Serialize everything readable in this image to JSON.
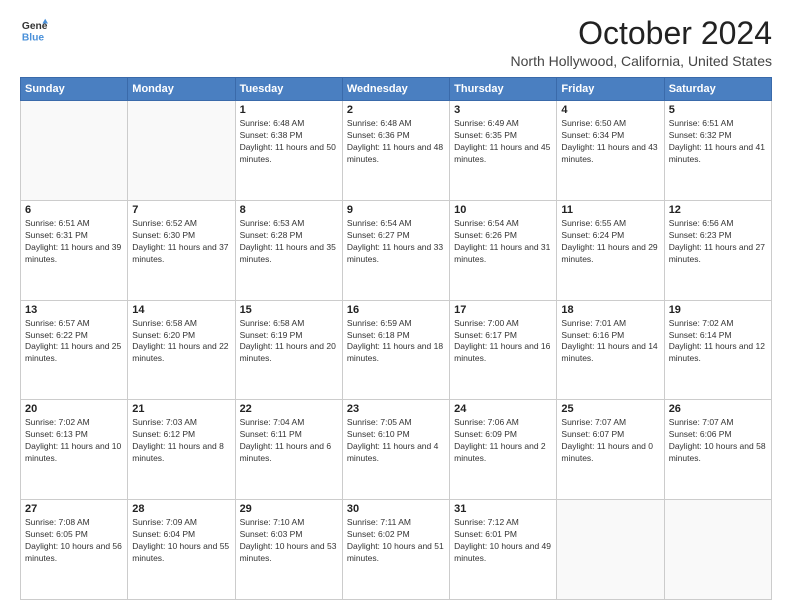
{
  "header": {
    "logo_line1": "General",
    "logo_line2": "Blue",
    "title": "October 2024",
    "subtitle": "North Hollywood, California, United States"
  },
  "days_of_week": [
    "Sunday",
    "Monday",
    "Tuesday",
    "Wednesday",
    "Thursday",
    "Friday",
    "Saturday"
  ],
  "weeks": [
    [
      {
        "day": "",
        "info": ""
      },
      {
        "day": "",
        "info": ""
      },
      {
        "day": "1",
        "info": "Sunrise: 6:48 AM\nSunset: 6:38 PM\nDaylight: 11 hours and 50 minutes."
      },
      {
        "day": "2",
        "info": "Sunrise: 6:48 AM\nSunset: 6:36 PM\nDaylight: 11 hours and 48 minutes."
      },
      {
        "day": "3",
        "info": "Sunrise: 6:49 AM\nSunset: 6:35 PM\nDaylight: 11 hours and 45 minutes."
      },
      {
        "day": "4",
        "info": "Sunrise: 6:50 AM\nSunset: 6:34 PM\nDaylight: 11 hours and 43 minutes."
      },
      {
        "day": "5",
        "info": "Sunrise: 6:51 AM\nSunset: 6:32 PM\nDaylight: 11 hours and 41 minutes."
      }
    ],
    [
      {
        "day": "6",
        "info": "Sunrise: 6:51 AM\nSunset: 6:31 PM\nDaylight: 11 hours and 39 minutes."
      },
      {
        "day": "7",
        "info": "Sunrise: 6:52 AM\nSunset: 6:30 PM\nDaylight: 11 hours and 37 minutes."
      },
      {
        "day": "8",
        "info": "Sunrise: 6:53 AM\nSunset: 6:28 PM\nDaylight: 11 hours and 35 minutes."
      },
      {
        "day": "9",
        "info": "Sunrise: 6:54 AM\nSunset: 6:27 PM\nDaylight: 11 hours and 33 minutes."
      },
      {
        "day": "10",
        "info": "Sunrise: 6:54 AM\nSunset: 6:26 PM\nDaylight: 11 hours and 31 minutes."
      },
      {
        "day": "11",
        "info": "Sunrise: 6:55 AM\nSunset: 6:24 PM\nDaylight: 11 hours and 29 minutes."
      },
      {
        "day": "12",
        "info": "Sunrise: 6:56 AM\nSunset: 6:23 PM\nDaylight: 11 hours and 27 minutes."
      }
    ],
    [
      {
        "day": "13",
        "info": "Sunrise: 6:57 AM\nSunset: 6:22 PM\nDaylight: 11 hours and 25 minutes."
      },
      {
        "day": "14",
        "info": "Sunrise: 6:58 AM\nSunset: 6:20 PM\nDaylight: 11 hours and 22 minutes."
      },
      {
        "day": "15",
        "info": "Sunrise: 6:58 AM\nSunset: 6:19 PM\nDaylight: 11 hours and 20 minutes."
      },
      {
        "day": "16",
        "info": "Sunrise: 6:59 AM\nSunset: 6:18 PM\nDaylight: 11 hours and 18 minutes."
      },
      {
        "day": "17",
        "info": "Sunrise: 7:00 AM\nSunset: 6:17 PM\nDaylight: 11 hours and 16 minutes."
      },
      {
        "day": "18",
        "info": "Sunrise: 7:01 AM\nSunset: 6:16 PM\nDaylight: 11 hours and 14 minutes."
      },
      {
        "day": "19",
        "info": "Sunrise: 7:02 AM\nSunset: 6:14 PM\nDaylight: 11 hours and 12 minutes."
      }
    ],
    [
      {
        "day": "20",
        "info": "Sunrise: 7:02 AM\nSunset: 6:13 PM\nDaylight: 11 hours and 10 minutes."
      },
      {
        "day": "21",
        "info": "Sunrise: 7:03 AM\nSunset: 6:12 PM\nDaylight: 11 hours and 8 minutes."
      },
      {
        "day": "22",
        "info": "Sunrise: 7:04 AM\nSunset: 6:11 PM\nDaylight: 11 hours and 6 minutes."
      },
      {
        "day": "23",
        "info": "Sunrise: 7:05 AM\nSunset: 6:10 PM\nDaylight: 11 hours and 4 minutes."
      },
      {
        "day": "24",
        "info": "Sunrise: 7:06 AM\nSunset: 6:09 PM\nDaylight: 11 hours and 2 minutes."
      },
      {
        "day": "25",
        "info": "Sunrise: 7:07 AM\nSunset: 6:07 PM\nDaylight: 11 hours and 0 minutes."
      },
      {
        "day": "26",
        "info": "Sunrise: 7:07 AM\nSunset: 6:06 PM\nDaylight: 10 hours and 58 minutes."
      }
    ],
    [
      {
        "day": "27",
        "info": "Sunrise: 7:08 AM\nSunset: 6:05 PM\nDaylight: 10 hours and 56 minutes."
      },
      {
        "day": "28",
        "info": "Sunrise: 7:09 AM\nSunset: 6:04 PM\nDaylight: 10 hours and 55 minutes."
      },
      {
        "day": "29",
        "info": "Sunrise: 7:10 AM\nSunset: 6:03 PM\nDaylight: 10 hours and 53 minutes."
      },
      {
        "day": "30",
        "info": "Sunrise: 7:11 AM\nSunset: 6:02 PM\nDaylight: 10 hours and 51 minutes."
      },
      {
        "day": "31",
        "info": "Sunrise: 7:12 AM\nSunset: 6:01 PM\nDaylight: 10 hours and 49 minutes."
      },
      {
        "day": "",
        "info": ""
      },
      {
        "day": "",
        "info": ""
      }
    ]
  ]
}
